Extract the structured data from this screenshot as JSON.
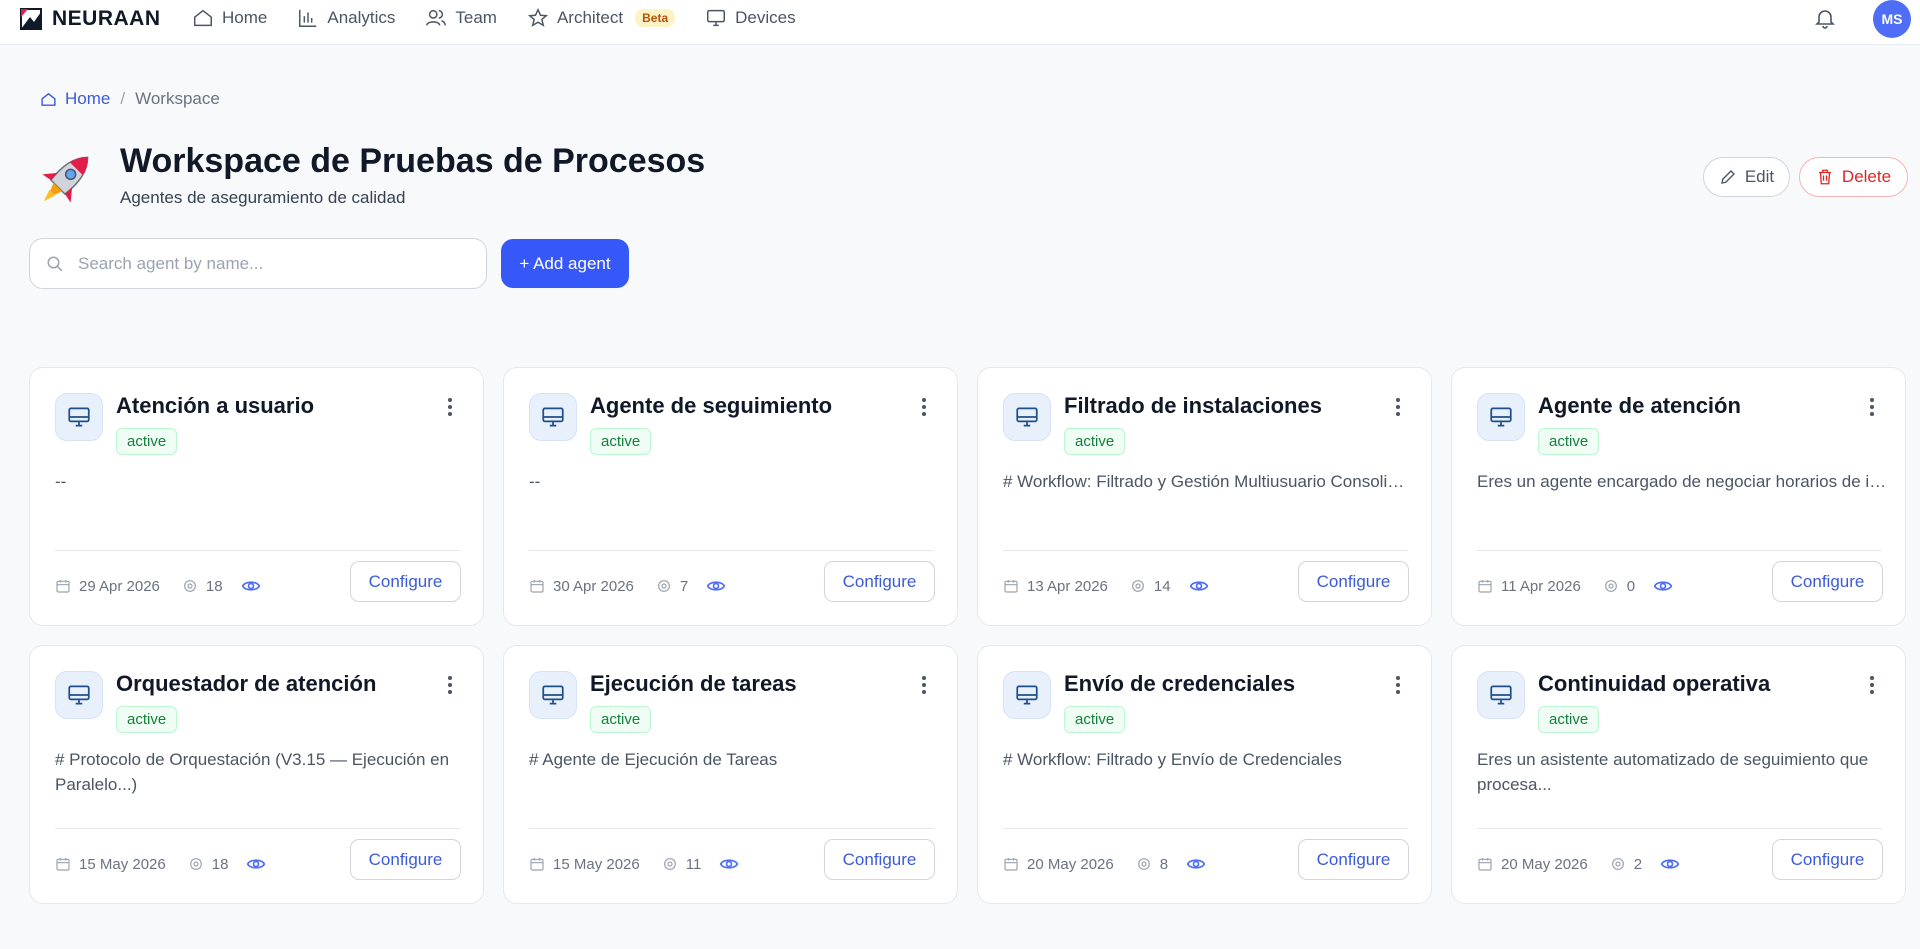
{
  "nav": {
    "brand": "NEURAAN",
    "items": [
      {
        "label": "Home",
        "icon": "home-icon"
      },
      {
        "label": "Analytics",
        "icon": "bar-chart-icon"
      },
      {
        "label": "Team",
        "icon": "users-icon"
      },
      {
        "label": "Architect",
        "icon": "star-icon",
        "badge": "Beta"
      },
      {
        "label": "Devices",
        "icon": "monitor-icon"
      }
    ],
    "avatar": "MS"
  },
  "breadcrumb": {
    "home": "Home",
    "separator": "/",
    "current": "Workspace"
  },
  "header": {
    "title": "Workspace de Pruebas de Procesos",
    "subtitle": "Agentes de aseguramiento de calidad",
    "edit_label": "Edit",
    "delete_label": "Delete"
  },
  "search": {
    "placeholder": "Search agent by name...",
    "value": ""
  },
  "add_agent_label": "+ Add agent",
  "colors": {
    "accent": "#3758f9",
    "active_green": "#15803d",
    "delete_red": "#dc2626"
  },
  "agents": [
    {
      "name": "Atención a usuario",
      "status": "active",
      "description": "--",
      "date": "29 Apr 2026",
      "count": "18",
      "configure": "Configure"
    },
    {
      "name": "Agente de seguimiento",
      "status": "active",
      "description": "--",
      "date": "30 Apr 2026",
      "count": "7",
      "configure": "Configure"
    },
    {
      "name": "Filtrado de instalaciones",
      "status": "active",
      "description": "# Workflow: Filtrado y Gestión Multiusuario Consolidado",
      "date": "13 Apr 2026",
      "count": "14",
      "configure": "Configure"
    },
    {
      "name": "Agente de atención",
      "status": "active",
      "description": "Eres un agente encargado de negociar horarios de instalación",
      "date": "11 Apr 2026",
      "count": "0",
      "configure": "Configure"
    },
    {
      "name": "Orquestador de atención",
      "status": "active",
      "description": "# Protocolo de Orquestación (V3.15 — Ejecución en Paralelo...)",
      "date": "15 May 2026",
      "count": "18",
      "configure": "Configure"
    },
    {
      "name": "Ejecución de tareas",
      "status": "active",
      "description": "# Agente de Ejecución de Tareas",
      "date": "15 May 2026",
      "count": "11",
      "configure": "Configure"
    },
    {
      "name": "Envío de credenciales",
      "status": "active",
      "description": "# Workflow: Filtrado y Envío de Credenciales",
      "date": "20 May 2026",
      "count": "8",
      "configure": "Configure"
    },
    {
      "name": "Continuidad operativa",
      "status": "active",
      "description": "Eres un asistente automatizado de seguimiento que procesa...",
      "date": "20 May 2026",
      "count": "2",
      "configure": "Configure"
    }
  ]
}
